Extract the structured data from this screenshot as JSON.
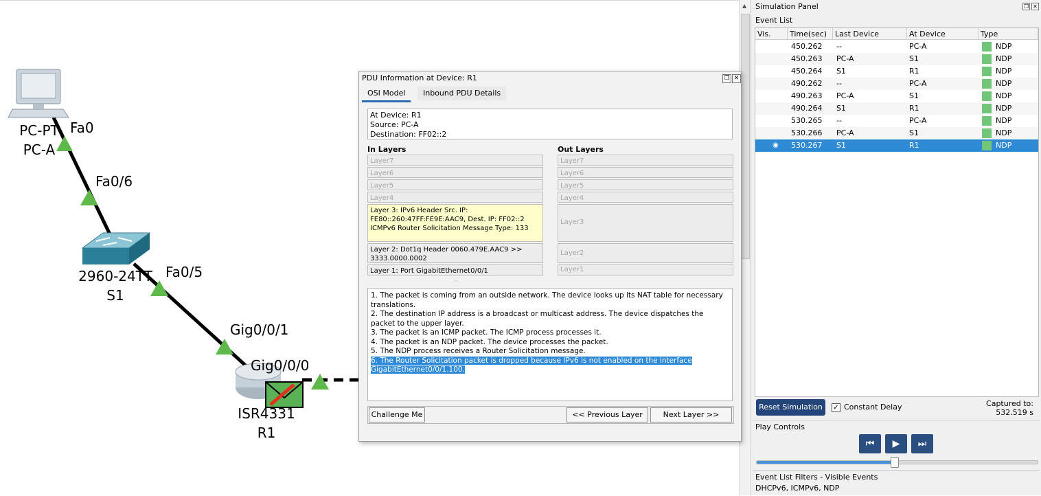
{
  "topology": {
    "devices": [
      {
        "model": "PC-PT",
        "name": "PC-A"
      },
      {
        "model": "2960-24TT",
        "name": "S1"
      },
      {
        "model": "ISR4331",
        "name": "R1"
      }
    ],
    "ports": {
      "pc_fa0": "Fa0",
      "s1_fa06": "Fa0/6",
      "s1_fa05": "Fa0/5",
      "r1_gig001": "Gig0/0/1",
      "r1_gig000": "Gig0/0/0"
    }
  },
  "pdu_window": {
    "title": "PDU Information at Device: R1",
    "tabs": [
      "OSI Model",
      "Inbound PDU Details"
    ],
    "active_tab": "OSI Model",
    "info": {
      "at_device": "At Device: R1",
      "source": "Source: PC-A",
      "destination": "Destination: FF02::2"
    },
    "in_layers_title": "In Layers",
    "out_layers_title": "Out Layers",
    "in_layers": {
      "l7": "Layer7",
      "l6": "Layer6",
      "l5": "Layer5",
      "l4": "Layer4",
      "l3": "Layer 3: IPv6 Header Src. IP: FE80::260:47FF:FE9E:AAC9, Dest. IP: FF02::2 ICMPv6 Router Solicitation Message Type: 133",
      "l2": "Layer 2: Dot1q Header 0060.479E.AAC9 >> 3333.0000.0002",
      "l1": "Layer 1: Port GigabitEthernet0/0/1"
    },
    "out_layers": {
      "l7": "Layer7",
      "l6": "Layer6",
      "l5": "Layer5",
      "l4": "Layer4",
      "l3": "Layer3",
      "l2": "Layer2",
      "l1": "Layer1"
    },
    "description": [
      "1. The packet is coming from an outside network. The device looks up its NAT table for necessary translations.",
      "2. The destination IP address is a broadcast or multicast address. The device dispatches the packet to the upper layer.",
      "3. The packet is an ICMP packet. The ICMP process processes it.",
      "4. The packet is an NDP packet. The device processes the packet.",
      "5. The NDP process receives a Router Solicitation message.",
      "6. The Router Solicitation packet is dropped because IPv6 is not enabled on the interface GigabitEthernet0/0/1.100."
    ],
    "buttons": {
      "challenge": "Challenge Me",
      "prev": "<< Previous Layer",
      "next": "Next Layer >>"
    }
  },
  "simulation_panel": {
    "title": "Simulation Panel",
    "event_list_label": "Event List",
    "columns": [
      "Vis.",
      "Time(sec)",
      "Last Device",
      "At Device",
      "Type"
    ],
    "events": [
      {
        "time": "450.262",
        "last": "--",
        "at": "PC-A",
        "type": "NDP"
      },
      {
        "time": "450.263",
        "last": "PC-A",
        "at": "S1",
        "type": "NDP"
      },
      {
        "time": "450.264",
        "last": "S1",
        "at": "R1",
        "type": "NDP"
      },
      {
        "time": "490.262",
        "last": "--",
        "at": "PC-A",
        "type": "NDP"
      },
      {
        "time": "490.263",
        "last": "PC-A",
        "at": "S1",
        "type": "NDP"
      },
      {
        "time": "490.264",
        "last": "S1",
        "at": "R1",
        "type": "NDP"
      },
      {
        "time": "530.265",
        "last": "--",
        "at": "PC-A",
        "type": "NDP"
      },
      {
        "time": "530.266",
        "last": "PC-A",
        "at": "S1",
        "type": "NDP"
      },
      {
        "time": "530.267",
        "last": "S1",
        "at": "R1",
        "type": "NDP",
        "selected": true
      }
    ],
    "type_color": "#71c67a",
    "reset_label": "Reset Simulation",
    "constant_delay_label": "Constant Delay",
    "constant_delay_checked": true,
    "captured_label": "Captured to:",
    "captured_value": "532.519 s",
    "play_controls_label": "Play Controls",
    "speed_fraction": 0.49,
    "filters_label": "Event List Filters - Visible Events",
    "filters_value": "DHCPv6, ICMPv6, NDP"
  },
  "colors": {
    "accent": "#2f8ad6",
    "play_button": "#2b4e80",
    "layer_highlight": "#ffffcc"
  }
}
